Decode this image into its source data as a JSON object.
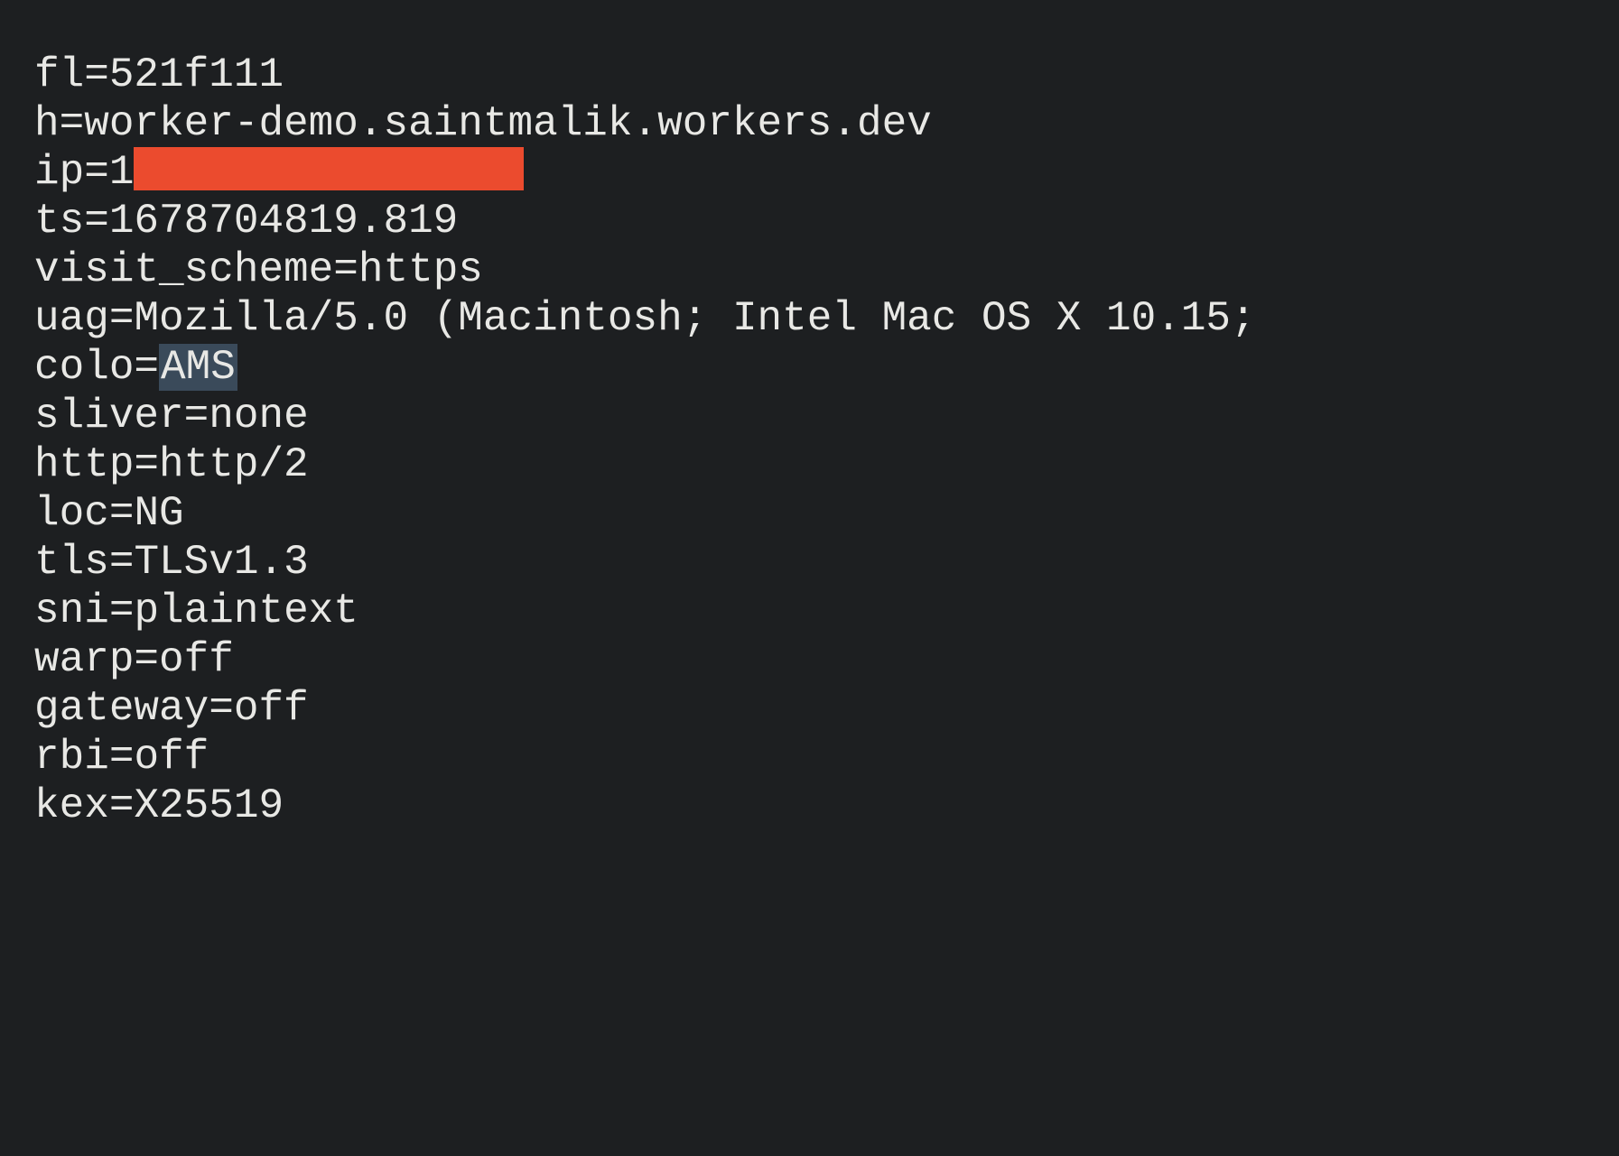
{
  "lines": {
    "fl": {
      "key": "fl",
      "value": "521f111"
    },
    "h": {
      "key": "h",
      "value": "worker-demo.saintmalik.workers.dev"
    },
    "ip": {
      "key": "ip",
      "prefix": "1"
    },
    "ts": {
      "key": "ts",
      "value": "1678704819.819"
    },
    "visit_scheme": {
      "key": "visit_scheme",
      "value": "https"
    },
    "uag": {
      "key": "uag",
      "value": "Mozilla/5.0 (Macintosh; Intel Mac OS X 10.15;"
    },
    "colo": {
      "key": "colo",
      "value": "AMS"
    },
    "sliver": {
      "key": "sliver",
      "value": "none"
    },
    "http": {
      "key": "http",
      "value": "http/2"
    },
    "loc": {
      "key": "loc",
      "value": "NG"
    },
    "tls": {
      "key": "tls",
      "value": "TLSv1.3"
    },
    "sni": {
      "key": "sni",
      "value": "plaintext"
    },
    "warp": {
      "key": "warp",
      "value": "off"
    },
    "gateway": {
      "key": "gateway",
      "value": "off"
    },
    "rbi": {
      "key": "rbi",
      "value": "off"
    },
    "kex": {
      "key": "kex",
      "value": "X25519"
    }
  },
  "eq": "="
}
